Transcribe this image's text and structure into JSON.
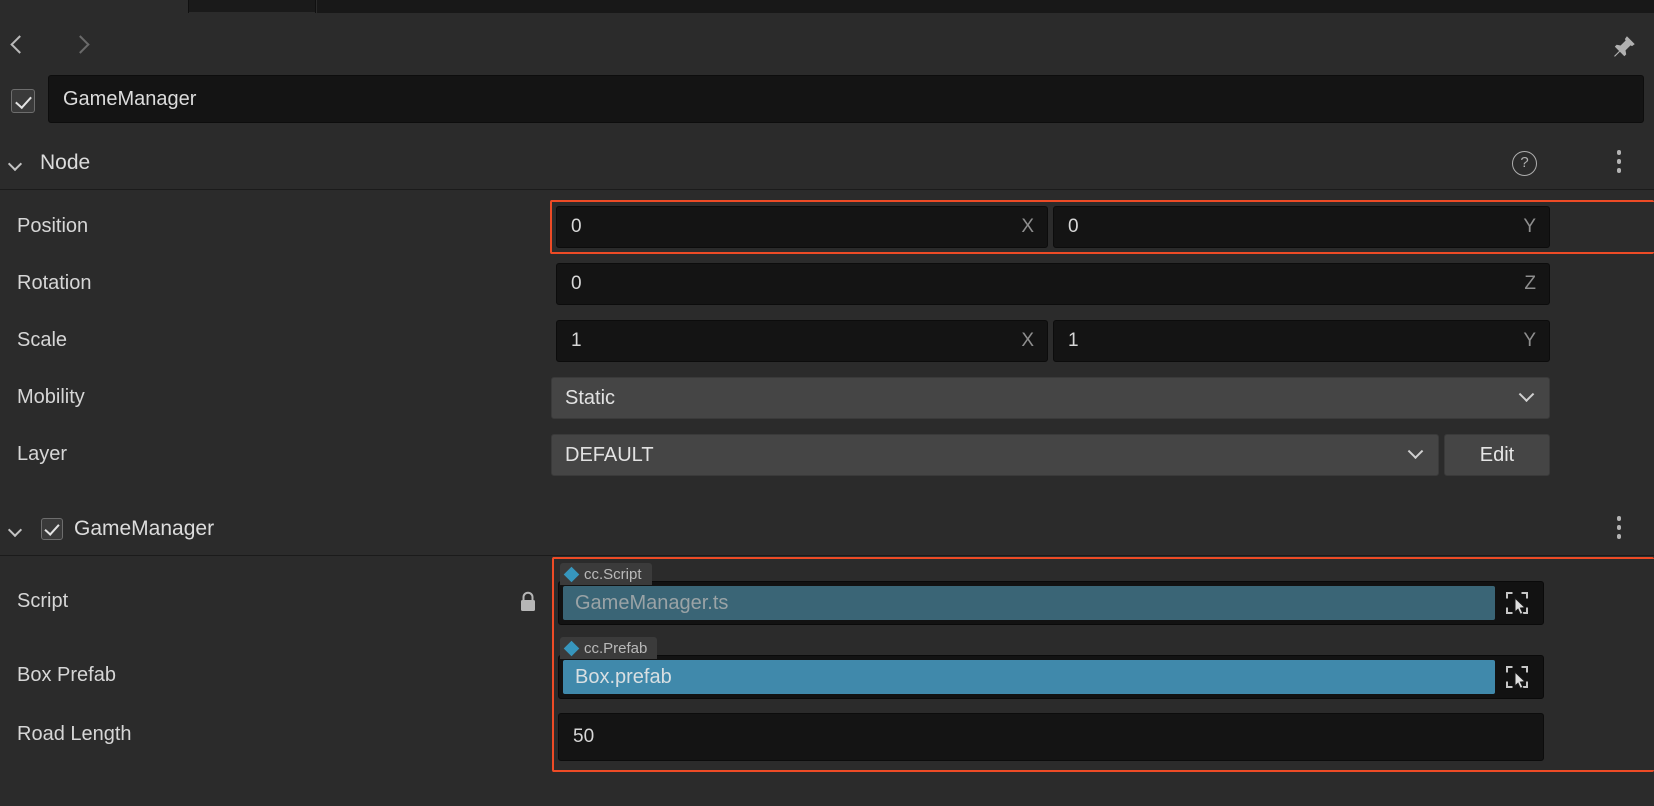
{
  "window": {
    "nav": {
      "back_icon": "chevron-left-icon",
      "forward_icon": "chevron-right-icon",
      "pin_icon": "pin-icon"
    }
  },
  "node_name": {
    "value": "GameManager",
    "enabled": true
  },
  "node_section": {
    "title": "Node",
    "help_icon": "help-circle-icon",
    "menu_icon": "kebab-menu-icon",
    "properties": {
      "position": {
        "label": "Position",
        "x": "0",
        "y": "0",
        "x_axis": "X",
        "y_axis": "Y",
        "highlighted": true
      },
      "rotation": {
        "label": "Rotation",
        "z": "0",
        "z_axis": "Z"
      },
      "scale": {
        "label": "Scale",
        "x": "1",
        "y": "1",
        "x_axis": "X",
        "y_axis": "Y"
      },
      "mobility": {
        "label": "Mobility",
        "value": "Static"
      },
      "layer": {
        "label": "Layer",
        "value": "DEFAULT",
        "edit_label": "Edit"
      }
    }
  },
  "component_section": {
    "title": "GameManager",
    "enabled": true,
    "menu_icon": "kebab-menu-icon",
    "properties": {
      "script": {
        "label": "Script",
        "lock_icon": "lock-icon",
        "type_tag": "cc.Script",
        "value": "GameManager.ts",
        "pick_icon": "select-target-icon"
      },
      "box_prefab": {
        "label": "Box Prefab",
        "type_tag": "cc.Prefab",
        "value": "Box.prefab",
        "pick_icon": "select-target-icon"
      },
      "road_length": {
        "label": "Road Length",
        "value": "50"
      }
    }
  },
  "colors": {
    "highlight": "#ed4b26",
    "accent_blue": "#3796bd",
    "script_field": "#3a6576",
    "prefab_field": "#4089ab",
    "panel_bg": "#2b2b2b",
    "input_bg": "#141414"
  }
}
